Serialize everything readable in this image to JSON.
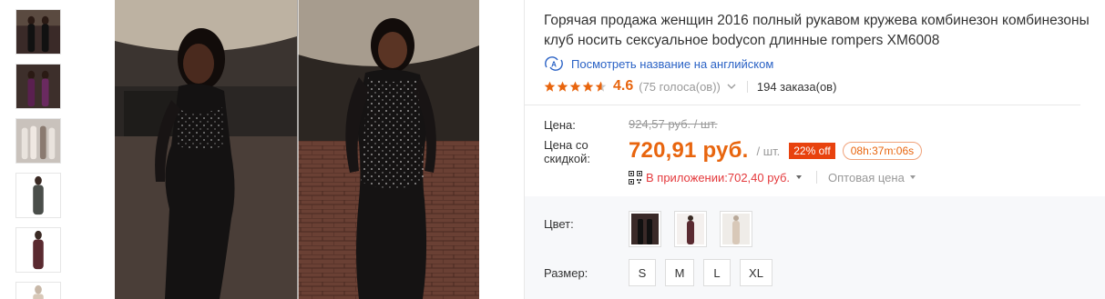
{
  "gallery": {
    "thumbnails": [
      "thumb-black-jumpsuit-1",
      "thumb-purple-jumpsuit",
      "thumb-white-jumpsuit-group",
      "thumb-grey-jumpsuit",
      "thumb-burgundy-jumpsuit",
      "thumb-beige-jumpsuit"
    ]
  },
  "product": {
    "title": "Горячая продажа женщин 2016 полный рукавом кружева комбинезон комбинезоны клуб носить сексуальное bodycon длинные rompers XM6008",
    "translate_link": "Посмотреть название на английском",
    "rating": "4.6",
    "votes": "(75 голоса(ов))",
    "orders": "194 заказа(ов)"
  },
  "price": {
    "price_label": "Цена:",
    "old_price": "924,57 руб. / шт.",
    "discount_label": "Цена со скидкой:",
    "new_price": "720,91 руб.",
    "per_unit": "/ шт.",
    "discount_badge": "22% off",
    "timer": "08h:37m:06s",
    "app_price": "В приложении:702,40 руб.",
    "wholesale": "Оптовая цена"
  },
  "options": {
    "color_label": "Цвет:",
    "size_label": "Размер:",
    "sizes": [
      "S",
      "M",
      "L",
      "XL"
    ]
  },
  "colors": {
    "accent_orange": "#e8650e",
    "discount_red": "#e8420e",
    "link_blue": "#2a62c5",
    "app_red": "#e4393c"
  }
}
